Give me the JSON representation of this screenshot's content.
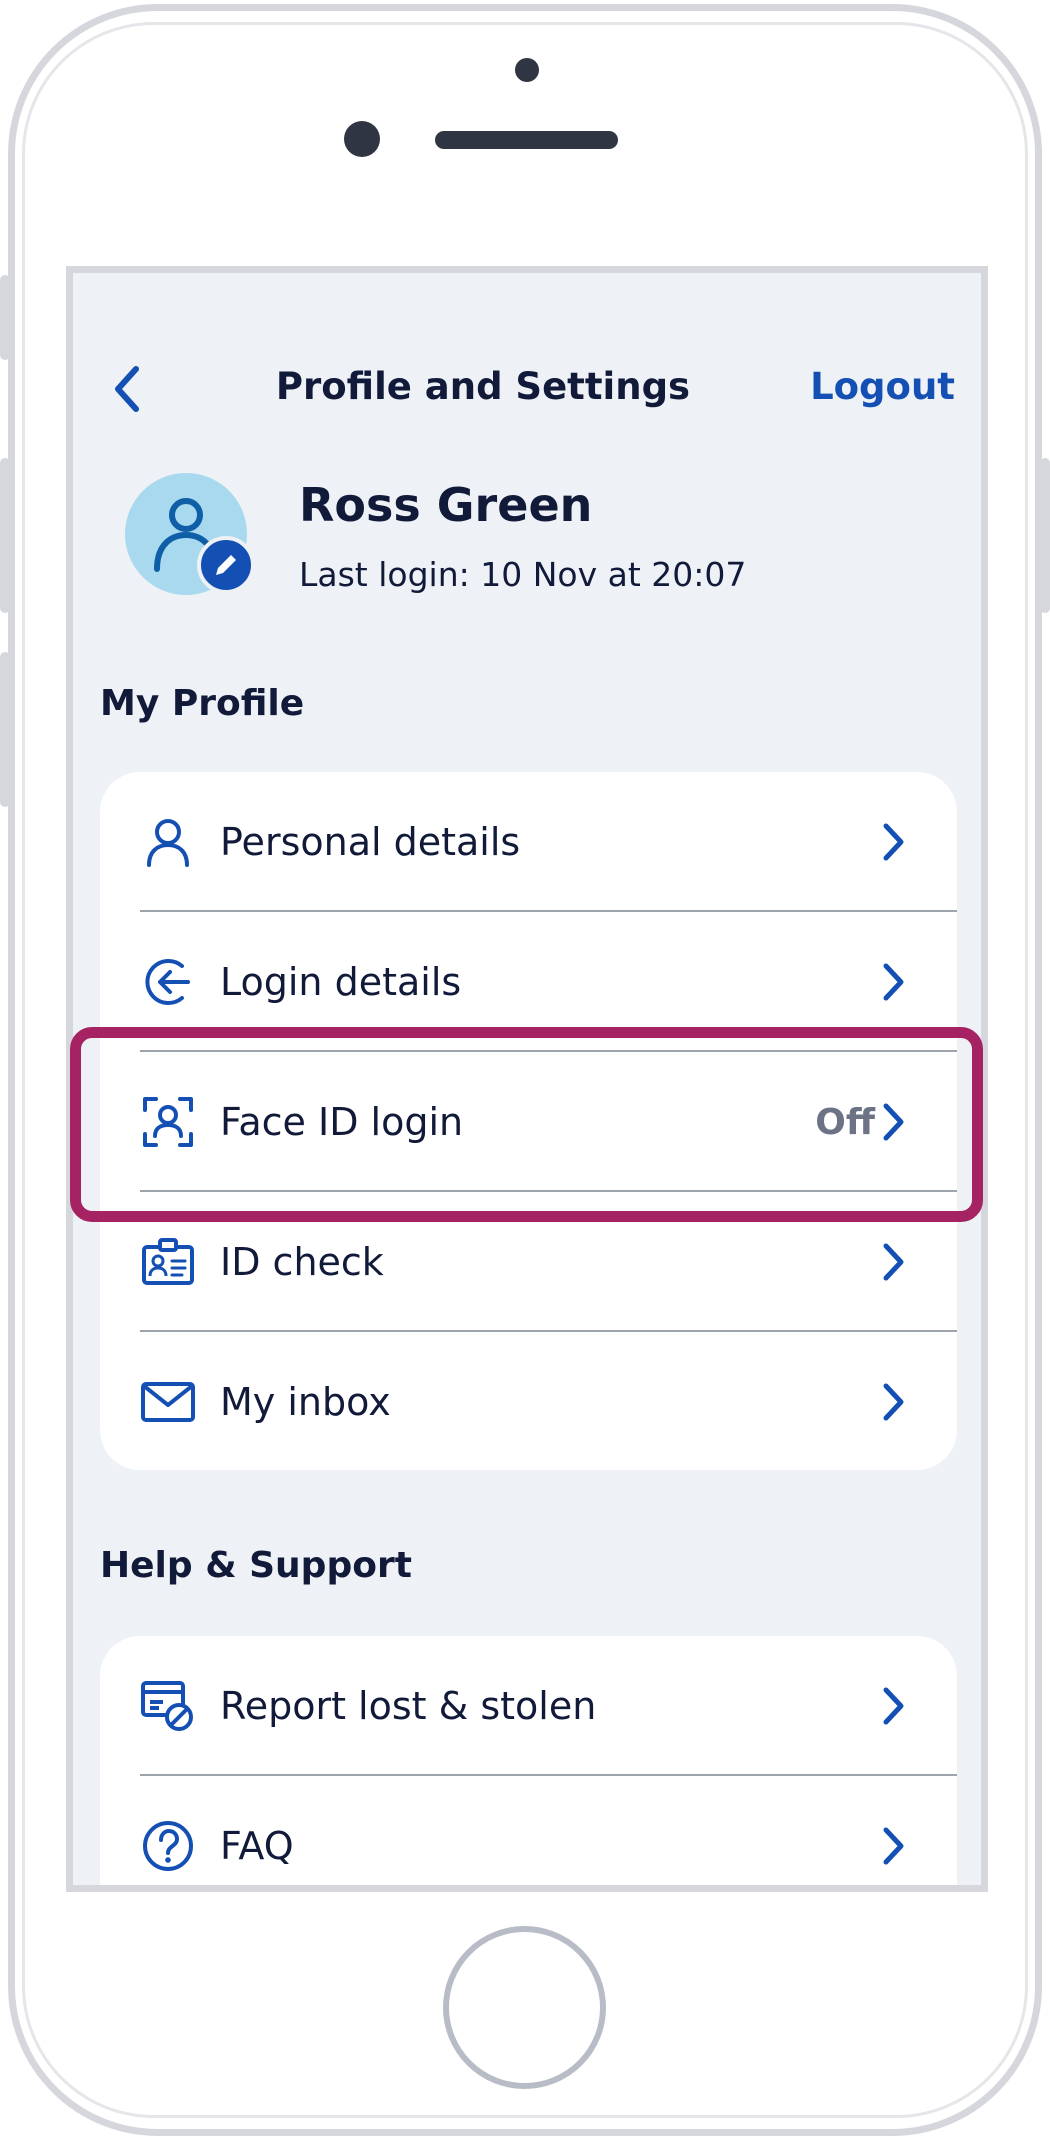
{
  "header": {
    "title": "Profile and Settings",
    "logout_label": "Logout"
  },
  "profile": {
    "name": "Ross Green",
    "last_login": "Last login: 10 Nov at 20:07"
  },
  "sections": {
    "my_profile": {
      "title": "My Profile",
      "items": [
        {
          "label": "Personal details",
          "value": "",
          "icon": "person-icon"
        },
        {
          "label": "Login details",
          "value": "",
          "icon": "login-arrow-icon"
        },
        {
          "label": "Face ID login",
          "value": "Off",
          "icon": "face-id-icon"
        },
        {
          "label": "ID check",
          "value": "",
          "icon": "id-card-icon"
        },
        {
          "label": "My inbox",
          "value": "",
          "icon": "envelope-icon"
        }
      ]
    },
    "help_support": {
      "title": "Help & Support",
      "items": [
        {
          "label": "Report lost & stolen",
          "value": "",
          "icon": "card-blocked-icon"
        },
        {
          "label": "FAQ",
          "value": "",
          "icon": "question-icon"
        }
      ]
    }
  },
  "colors": {
    "accent": "#1450b4",
    "highlight": "#a52363",
    "screen_background": "#eef1f5",
    "text": "#121a3a"
  }
}
